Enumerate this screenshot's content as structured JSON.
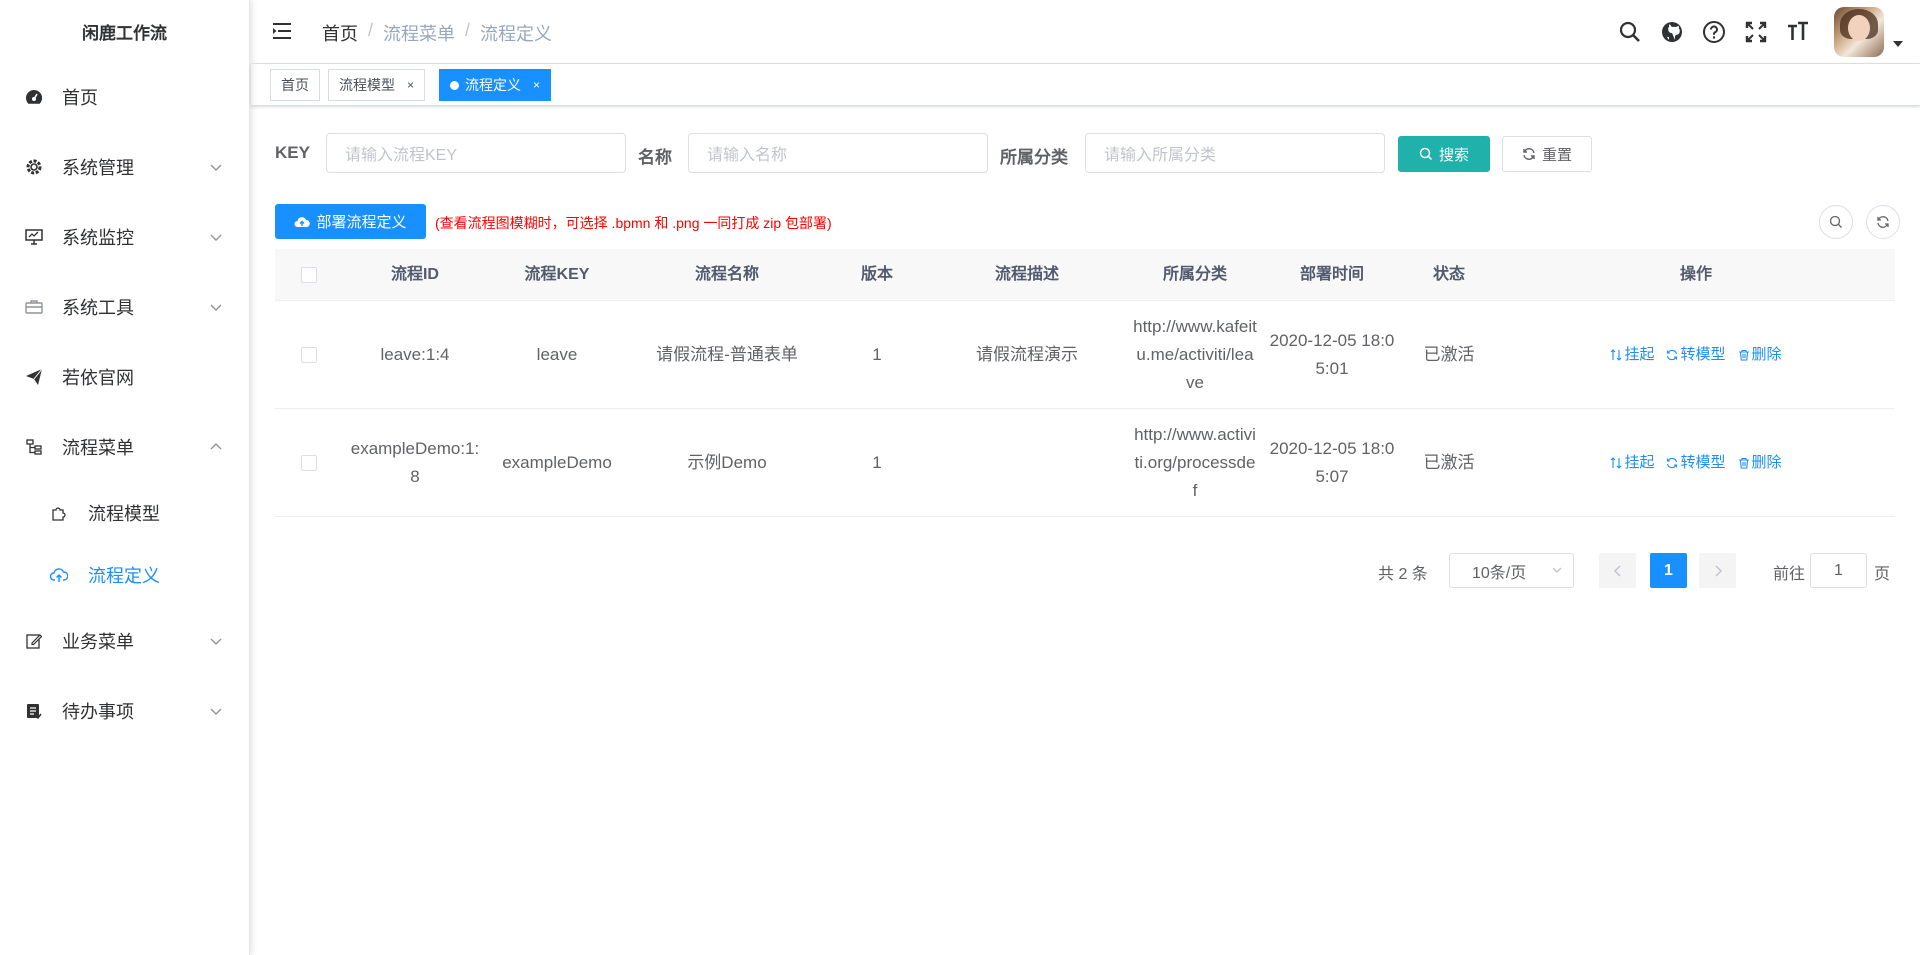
{
  "app": {
    "title": "闲鹿工作流"
  },
  "sidebar": {
    "items": [
      {
        "label": "首页",
        "icon": "dashboard-icon"
      },
      {
        "label": "系统管理",
        "icon": "gear-icon"
      },
      {
        "label": "系统监控",
        "icon": "monitor-icon"
      },
      {
        "label": "系统工具",
        "icon": "toolbox-icon"
      },
      {
        "label": "若依官网",
        "icon": "paper-plane-icon"
      },
      {
        "label": "流程菜单",
        "icon": "tree-icon"
      },
      {
        "label": "业务菜单",
        "icon": "edit-icon"
      },
      {
        "label": "待办事项",
        "icon": "todo-icon"
      }
    ],
    "sub_items": [
      {
        "label": "流程模型",
        "icon": "puzzle-icon"
      },
      {
        "label": "流程定义",
        "icon": "cloud-upload-icon"
      }
    ]
  },
  "breadcrumb": [
    "首页",
    "流程菜单",
    "流程定义"
  ],
  "breadcrumb_sep": "/",
  "tags": [
    {
      "label": "首页"
    },
    {
      "label": "流程模型",
      "close": "×"
    },
    {
      "label": "流程定义",
      "close": "×"
    }
  ],
  "search": {
    "key_label": "KEY",
    "key_placeholder": "请输入流程KEY",
    "name_label": "名称",
    "name_placeholder": "请输入名称",
    "category_label": "所属分类",
    "category_placeholder": "请输入所属分类",
    "search_button": "搜索",
    "reset_button": "重置"
  },
  "toolbar": {
    "deploy_button": "部署流程定义",
    "deploy_hint": "(查看流程图模糊时，可选择 .bpmn 和 .png 一同打成 zip 包部署)"
  },
  "table": {
    "columns": [
      "流程ID",
      "流程KEY",
      "流程名称",
      "版本",
      "流程描述",
      "所属分类",
      "部署时间",
      "状态",
      "操作"
    ],
    "rows": [
      {
        "id": "leave:1:4",
        "key": "leave",
        "name": "请假流程-普通表单",
        "version": "1",
        "desc": "请假流程演示",
        "category": "http://www.kafeitu.me/activiti/leave",
        "time": "2020-12-05 18:05:01",
        "status": "已激活"
      },
      {
        "id": "exampleDemo:1:8",
        "key": "exampleDemo",
        "name": "示例Demo",
        "version": "1",
        "desc": "",
        "category": "http://www.activiti.org/processdef",
        "time": "2020-12-05 18:05:07",
        "status": "已激活"
      }
    ],
    "ops": {
      "suspend": "挂起",
      "convert": "转模型",
      "delete": "删除"
    }
  },
  "pagination": {
    "total": "共 2 条",
    "page_size": "10条/页",
    "current": "1",
    "goto_label": "前往",
    "goto_value": "1",
    "page_label": "页"
  },
  "colors": {
    "primary": "#1890ff",
    "search": "#20b2aa",
    "hint": "#ff0000"
  }
}
